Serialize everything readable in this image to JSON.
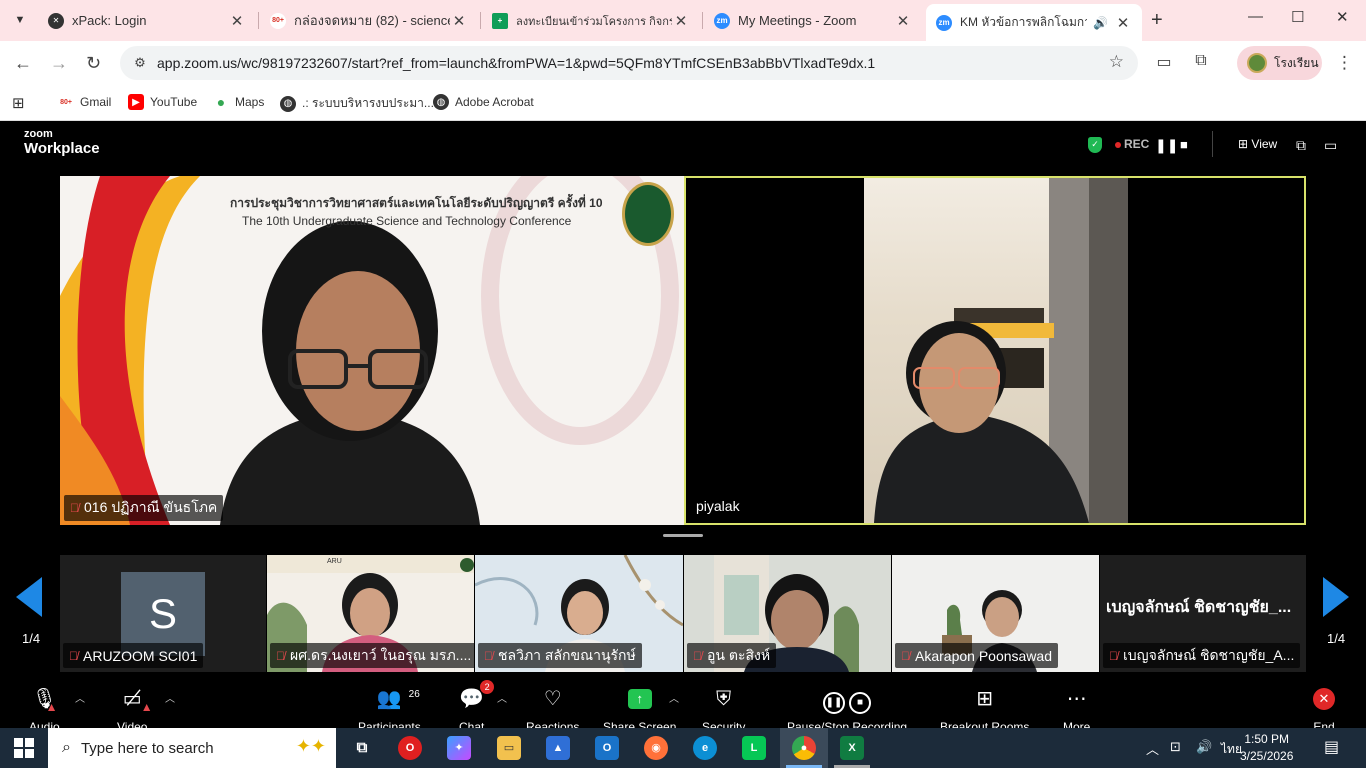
{
  "browser": {
    "tabs": [
      {
        "title": "xPack: Login",
        "icon": "x-icon",
        "color": "#333333"
      },
      {
        "title": "กล่องจดหมาย (82) - science@",
        "icon": "gmail-icon",
        "color": "#d93025",
        "badge": "80+"
      },
      {
        "title": "ลงทะเบียนเข้าร่วมโครงการ กิจกรร",
        "icon": "sheets-icon",
        "color": "#0f9d58"
      },
      {
        "title": "My Meetings - Zoom",
        "icon": "zoom-icon",
        "color": "#2d8cff",
        "badge": "zm"
      },
      {
        "title": "KM หัวข้อการพลิกโฉมการเรี",
        "icon": "zoom-icon",
        "color": "#2d8cff",
        "badge": "zm"
      }
    ],
    "url": "app.zoom.us/wc/98197232607/start?ref_from=launch&fromPWA=1&pwd=5QFm8YTmfCSEnB3abBbVTlxadTe9dx.1",
    "profile_name": "โรงเรียน",
    "bookmarks": [
      {
        "label": "Gmail",
        "icon": "gmail-icon",
        "badge": "80+"
      },
      {
        "label": "YouTube",
        "icon": "youtube-icon"
      },
      {
        "label": "Maps",
        "icon": "maps-icon"
      },
      {
        "label": ".: ระบบบริหารงบประมา...",
        "icon": "globe-icon"
      },
      {
        "label": "Adobe Acrobat",
        "icon": "globe-icon"
      }
    ]
  },
  "zoom": {
    "logo_small": "zoom",
    "logo_big": "Workplace",
    "rec_label": "REC",
    "view_label": "View",
    "speakers": [
      {
        "name": "016 ปฏิภาณี ขันธโภค",
        "muted": true,
        "conf_title_th": "การประชุมวิชาการวิทยาศาสตร์และเทคโนโลยีระดับปริญญาตรี ครั้งที่ 10",
        "conf_title_en": "The 10th Undergraduate Science and Technology Conference"
      },
      {
        "name": "piyalak",
        "muted": false
      }
    ],
    "thumbnails": [
      {
        "name": "ARUZOOM SCI01",
        "avatar": "S"
      },
      {
        "name": "ผศ.ดร.นงเยาว์ ในอรุณ มรภ....",
        "header": "ARU"
      },
      {
        "name": "ชลวิภา สลักขณานุรักษ์"
      },
      {
        "name": "อูน ตะสิงห์"
      },
      {
        "name": "Akarapon Poonsawad"
      },
      {
        "name": "เบญจลักษณ์ ชิดชาญชัย_A...",
        "big_name": "เบญจลักษณ์ ชิดชาญชัย_..."
      }
    ],
    "page_left": "1/4",
    "page_right": "1/4",
    "controls": {
      "audio": "Audio",
      "video": "Video",
      "participants": "Participants",
      "participants_count": "26",
      "chat": "Chat",
      "chat_count": "2",
      "reactions": "Reactions",
      "share": "Share Screen",
      "security": "Security",
      "recording": "Pause/Stop Recording",
      "breakout": "Breakout Rooms",
      "more": "More",
      "end": "End"
    }
  },
  "taskbar": {
    "search_placeholder": "Type here to search",
    "language": "ไทย",
    "time": "1:50 PM",
    "date": "3/25/2026"
  }
}
